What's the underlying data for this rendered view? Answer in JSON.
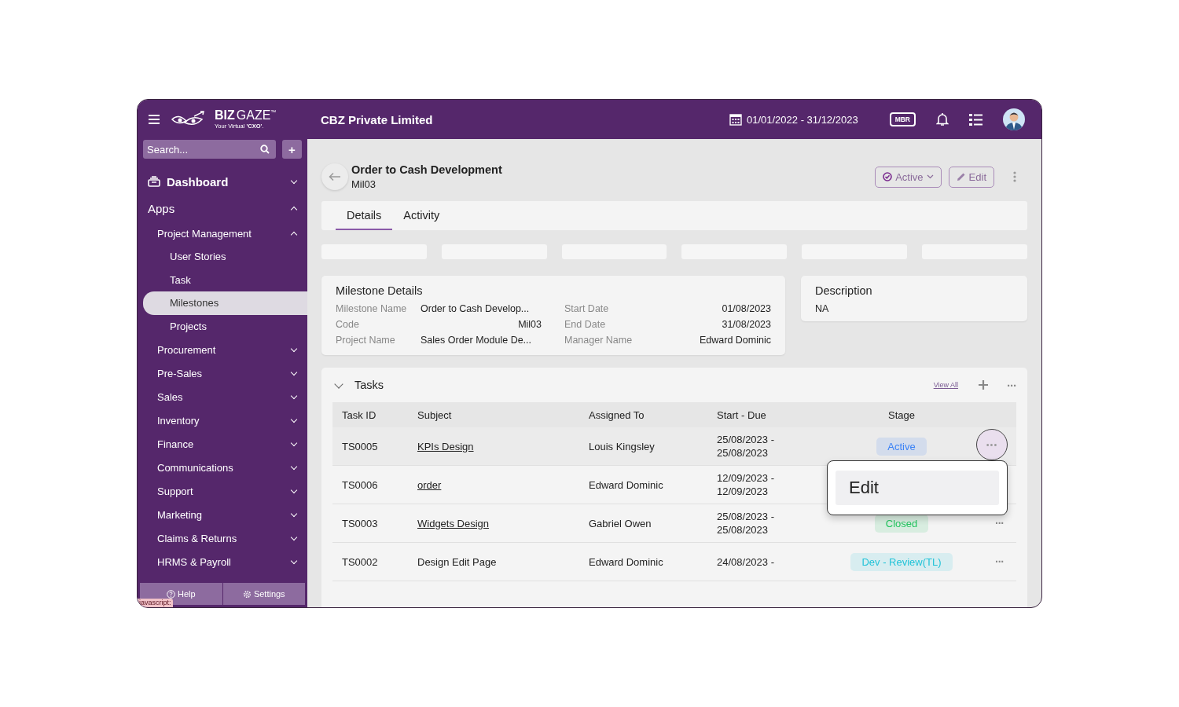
{
  "header": {
    "brand": "BIZ",
    "brand_2": "GAZE",
    "trademark": "™",
    "tagline": "Your Virtual **'CXO'**.",
    "company": "CBZ Private Limited",
    "date_range": "01/01/2022 - 31/12/2023",
    "badge": "MBR"
  },
  "sidebar": {
    "search_placeholder": "Search...",
    "add": "+",
    "nav": [
      {
        "label": "Dashboard",
        "kind": "link",
        "expanded": false
      },
      {
        "label": "Apps",
        "kind": "group",
        "expanded": true,
        "children": [
          {
            "label": "Project Management",
            "expanded": true,
            "children": [
              {
                "label": "User Stories",
                "selected": false
              },
              {
                "label": "Task",
                "selected": false
              },
              {
                "label": "Milestones",
                "selected": true
              },
              {
                "label": "Projects",
                "selected": false
              }
            ]
          },
          {
            "label": "Procurement",
            "expanded": false
          },
          {
            "label": "Pre-Sales",
            "expanded": false
          },
          {
            "label": "Sales",
            "expanded": false
          },
          {
            "label": "Inventory",
            "expanded": false
          },
          {
            "label": "Finance",
            "expanded": false
          },
          {
            "label": "Communications",
            "expanded": false
          },
          {
            "label": "Support",
            "expanded": false
          },
          {
            "label": "Marketing",
            "expanded": false
          },
          {
            "label": "Claims & Returns",
            "expanded": false
          },
          {
            "label": "HRMS & Payroll",
            "expanded": false
          }
        ]
      }
    ],
    "footer": [
      "Help",
      "Settings"
    ],
    "status_tip": "javascript:"
  },
  "record": {
    "title": "Order to Cash Development",
    "code": "Mil03",
    "status": "Active",
    "edit": "Edit"
  },
  "tabs": [
    {
      "label": "Details",
      "selected": true
    },
    {
      "label": "Activity",
      "selected": false
    }
  ],
  "milestone": {
    "title": "Milestone Details",
    "fields": [
      {
        "label": "Milestone Name",
        "value": "Order to Cash Develop..."
      },
      {
        "label": "Start Date",
        "value": "01/08/2023"
      },
      {
        "label": "Code",
        "value": "Mil03"
      },
      {
        "label": "End Date",
        "value": "31/08/2023"
      },
      {
        "label": "Project Name",
        "value": "Sales Order Module De..."
      },
      {
        "label": "Manager Name",
        "value": "Edward Dominic"
      }
    ]
  },
  "description": {
    "title": "Description",
    "text": "NA"
  },
  "tasks": {
    "title": "Tasks",
    "expanded": true,
    "view_all": "View All",
    "more": "···",
    "columns": [
      "Task ID",
      "Subject",
      "Assigned To",
      "Start - Due",
      "Stage"
    ],
    "rows": [
      {
        "id": "TS0005",
        "subject": "KPIs Design",
        "link": true,
        "assigned": "Louis Kingsley",
        "start": "25/08/2023 -",
        "due": "25/08/2023",
        "stage": "Active",
        "color": "#3b82f6",
        "selected": true,
        "actions": "•••"
      },
      {
        "id": "TS0006",
        "subject": "order",
        "link": true,
        "assigned": "Edward Dominic",
        "start": "12/09/2023 -",
        "due": "12/09/2023",
        "selected": false
      },
      {
        "id": "TS0003",
        "subject": "Widgets Design",
        "link": true,
        "assigned": "Gabriel Owen",
        "start": "25/08/2023 -",
        "due": "25/08/2023",
        "stage": "Closed",
        "color": "#22c55e",
        "selected": false,
        "actions": "···"
      },
      {
        "id": "TS0002",
        "subject": "Design Edit Page",
        "link": false,
        "assigned": "Edward Dominic",
        "start": "24/08/2023 -",
        "stage": "Dev - Review(TL)",
        "color": "#22c3d8",
        "selected": false,
        "actions": "···"
      }
    ],
    "menu": [
      "Edit"
    ]
  }
}
